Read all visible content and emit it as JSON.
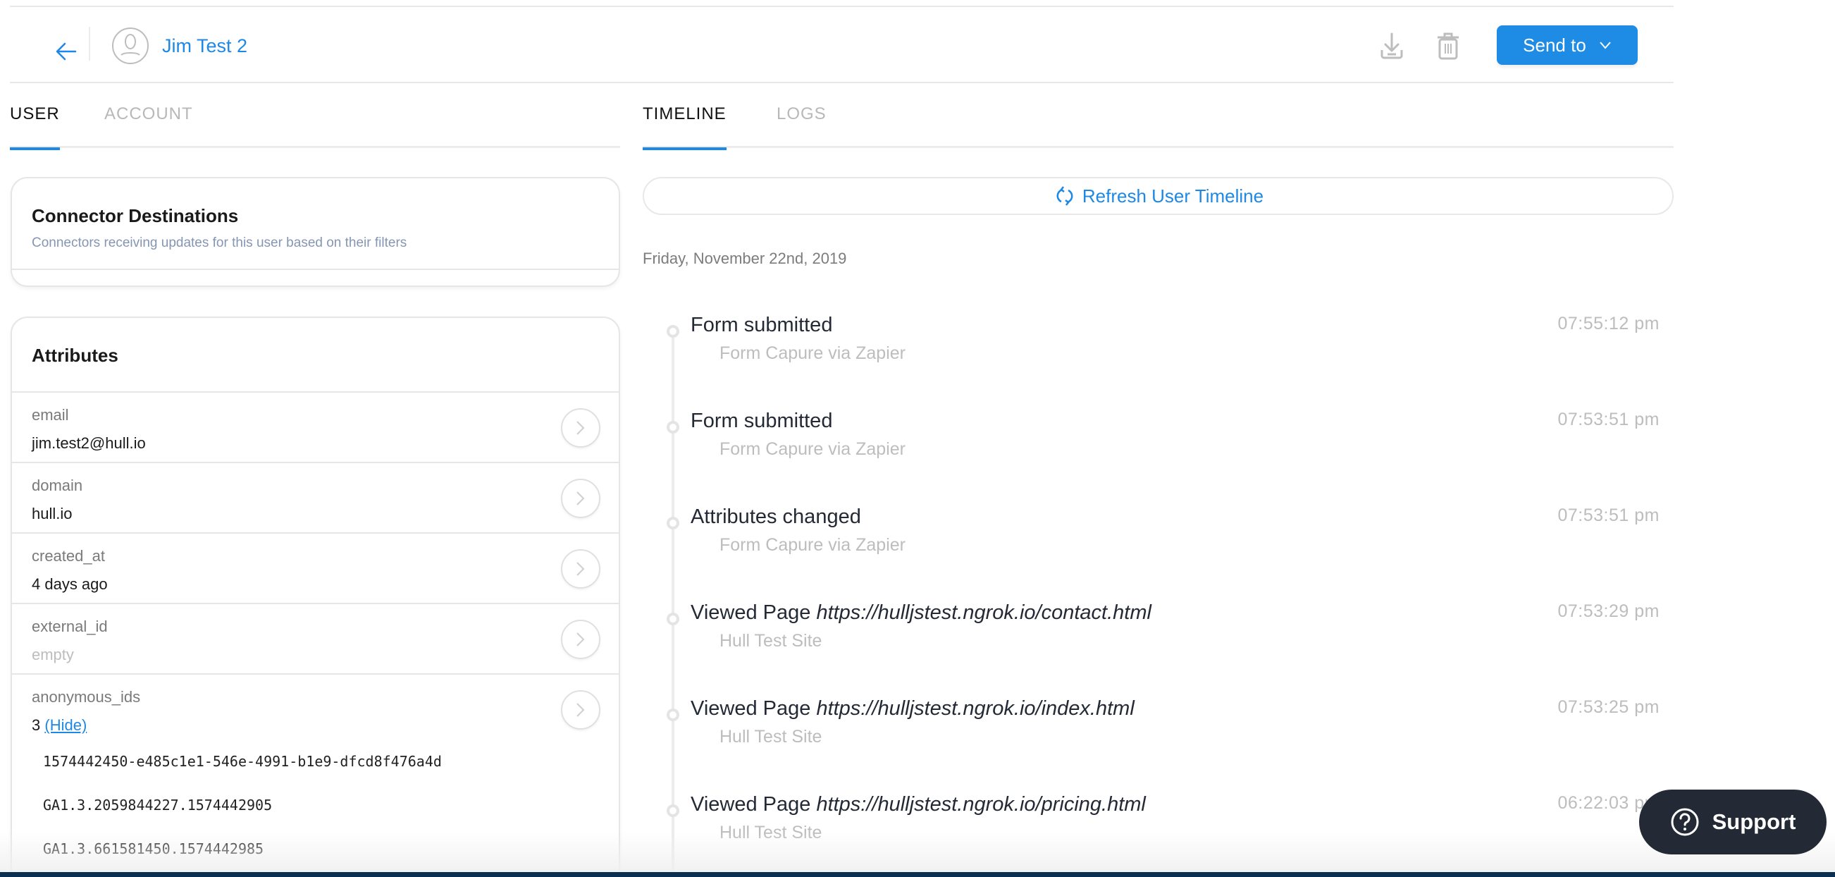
{
  "header": {
    "user_name": "Jim Test 2",
    "send_to_label": "Send to",
    "icons": {
      "back": "arrow-left-icon",
      "avatar": "user-avatar-icon",
      "download": "download-icon",
      "delete": "trash-icon",
      "dropdown": "chevron-down-icon"
    },
    "accent_color": "#1e88e5"
  },
  "left_tabs": [
    {
      "label": "USER",
      "active": true
    },
    {
      "label": "ACCOUNT",
      "active": false
    }
  ],
  "right_tabs": [
    {
      "label": "TIMELINE",
      "active": true
    },
    {
      "label": "LOGS",
      "active": false
    }
  ],
  "connectors_card": {
    "title": "Connector Destinations",
    "subtitle": "Connectors receiving updates for this user based on their filters"
  },
  "attributes_card": {
    "title": "Attributes",
    "rows": [
      {
        "label": "email",
        "value": "jim.test2@hull.io",
        "empty": false
      },
      {
        "label": "domain",
        "value": "hull.io",
        "empty": false
      },
      {
        "label": "created_at",
        "value": "4 days ago",
        "empty": false
      },
      {
        "label": "external_id",
        "value": "empty",
        "empty": true
      }
    ],
    "anonymous_ids": {
      "label": "anonymous_ids",
      "count": "3",
      "toggle_label": "(Hide)",
      "ids": [
        "1574442450-e485c1e1-546e-4991-b1e9-dfcd8f476a4d",
        "GA1.3.2059844227.1574442905",
        "GA1.3.661581450.1574442985"
      ]
    }
  },
  "timeline": {
    "refresh_label": "Refresh User Timeline",
    "date": "Friday, November 22nd, 2019",
    "events": [
      {
        "title": "Form submitted",
        "url": "",
        "source": "Form Capure via Zapier",
        "time": "07:55:12 pm"
      },
      {
        "title": "Form submitted",
        "url": "",
        "source": "Form Capure via Zapier",
        "time": "07:53:51 pm"
      },
      {
        "title": "Attributes changed",
        "url": "",
        "source": "Form Capure via Zapier",
        "time": "07:53:51 pm"
      },
      {
        "title": "Viewed Page",
        "url": "https://hulljstest.ngrok.io/contact.html",
        "source": "Hull Test Site",
        "time": "07:53:29 pm"
      },
      {
        "title": "Viewed Page",
        "url": "https://hulljstest.ngrok.io/index.html",
        "source": "Hull Test Site",
        "time": "07:53:25 pm"
      },
      {
        "title": "Viewed Page",
        "url": "https://hulljstest.ngrok.io/pricing.html",
        "source": "Hull Test Site",
        "time": "06:22:03 pm"
      }
    ]
  },
  "support": {
    "label": "Support",
    "icon": "question-circle-icon"
  }
}
